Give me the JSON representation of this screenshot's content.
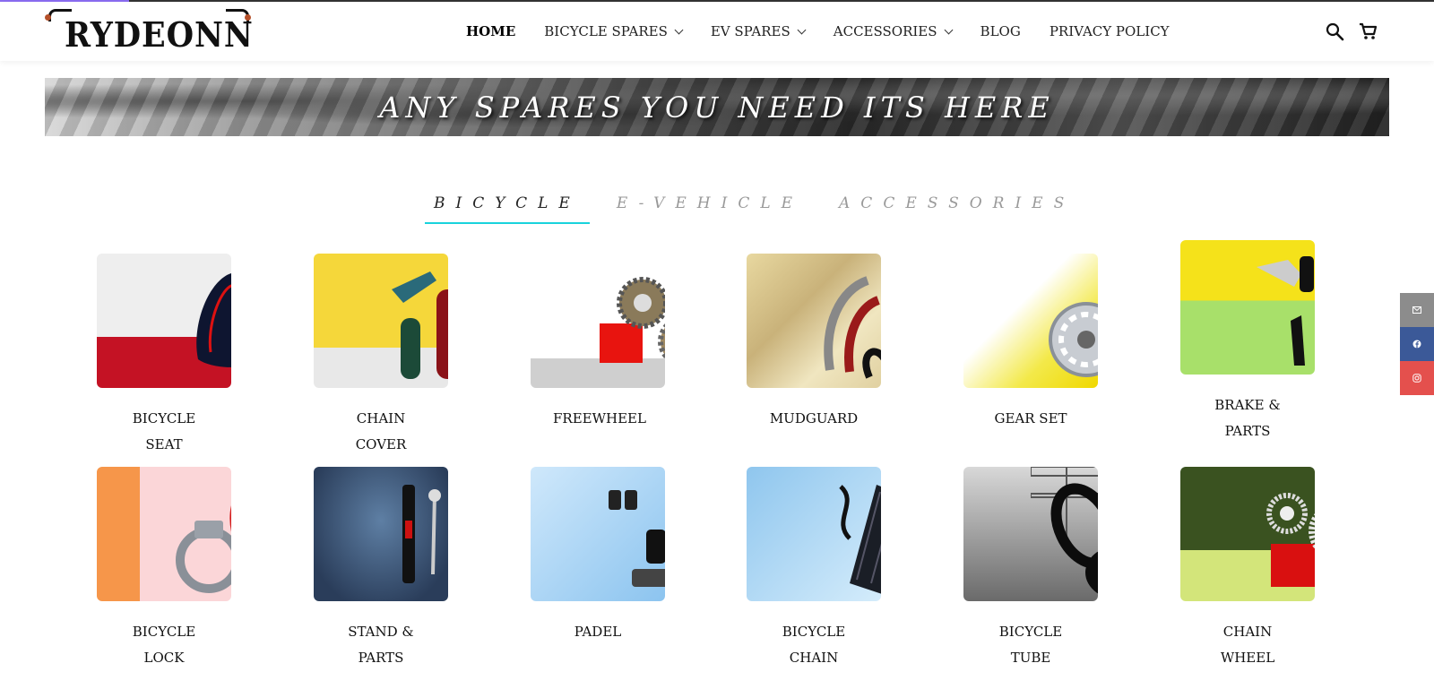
{
  "brand": {
    "logo_text": "RYDEONN"
  },
  "nav": {
    "items": [
      {
        "label": "HOME",
        "dropdown": false,
        "active": true
      },
      {
        "label": "BICYCLE SPARES",
        "dropdown": true,
        "active": false
      },
      {
        "label": "EV SPARES",
        "dropdown": true,
        "active": false
      },
      {
        "label": "ACCESSORIES",
        "dropdown": true,
        "active": false
      },
      {
        "label": "BLOG",
        "dropdown": false,
        "active": false
      },
      {
        "label": "PRIVACY POLICY",
        "dropdown": false,
        "active": false
      }
    ],
    "icons": [
      "search-icon",
      "cart-icon"
    ]
  },
  "banner": {
    "text": "ANY SPARES YOU NEED ITS HERE"
  },
  "tabs": [
    {
      "label": "BICYCLE",
      "active": true
    },
    {
      "label": "E-VEHICLE",
      "active": false
    },
    {
      "label": "ACCESSORIES",
      "active": false
    }
  ],
  "products": [
    {
      "label": "BICYCLE SEAT"
    },
    {
      "label": "CHAIN COVER"
    },
    {
      "label": "FREEWHEEL"
    },
    {
      "label": "MUDGUARD"
    },
    {
      "label": "GEAR SET"
    },
    {
      "label": "BRAKE & PARTS"
    },
    {
      "label": "BICYCLE LOCK"
    },
    {
      "label": "STAND & PARTS"
    },
    {
      "label": "PADEL"
    },
    {
      "label": "BICYCLE CHAIN"
    },
    {
      "label": "BICYCLE TUBE"
    },
    {
      "label": "CHAIN WHEEL"
    }
  ],
  "social": [
    {
      "icon": "mail-icon",
      "color": "#8c8c8c"
    },
    {
      "icon": "facebook-icon",
      "color": "#3b5998"
    },
    {
      "icon": "instagram-icon",
      "color": "#e4504d"
    }
  ],
  "colors": {
    "tab_underline": "#19d3dc",
    "page_progress": "#8a6cf0"
  }
}
